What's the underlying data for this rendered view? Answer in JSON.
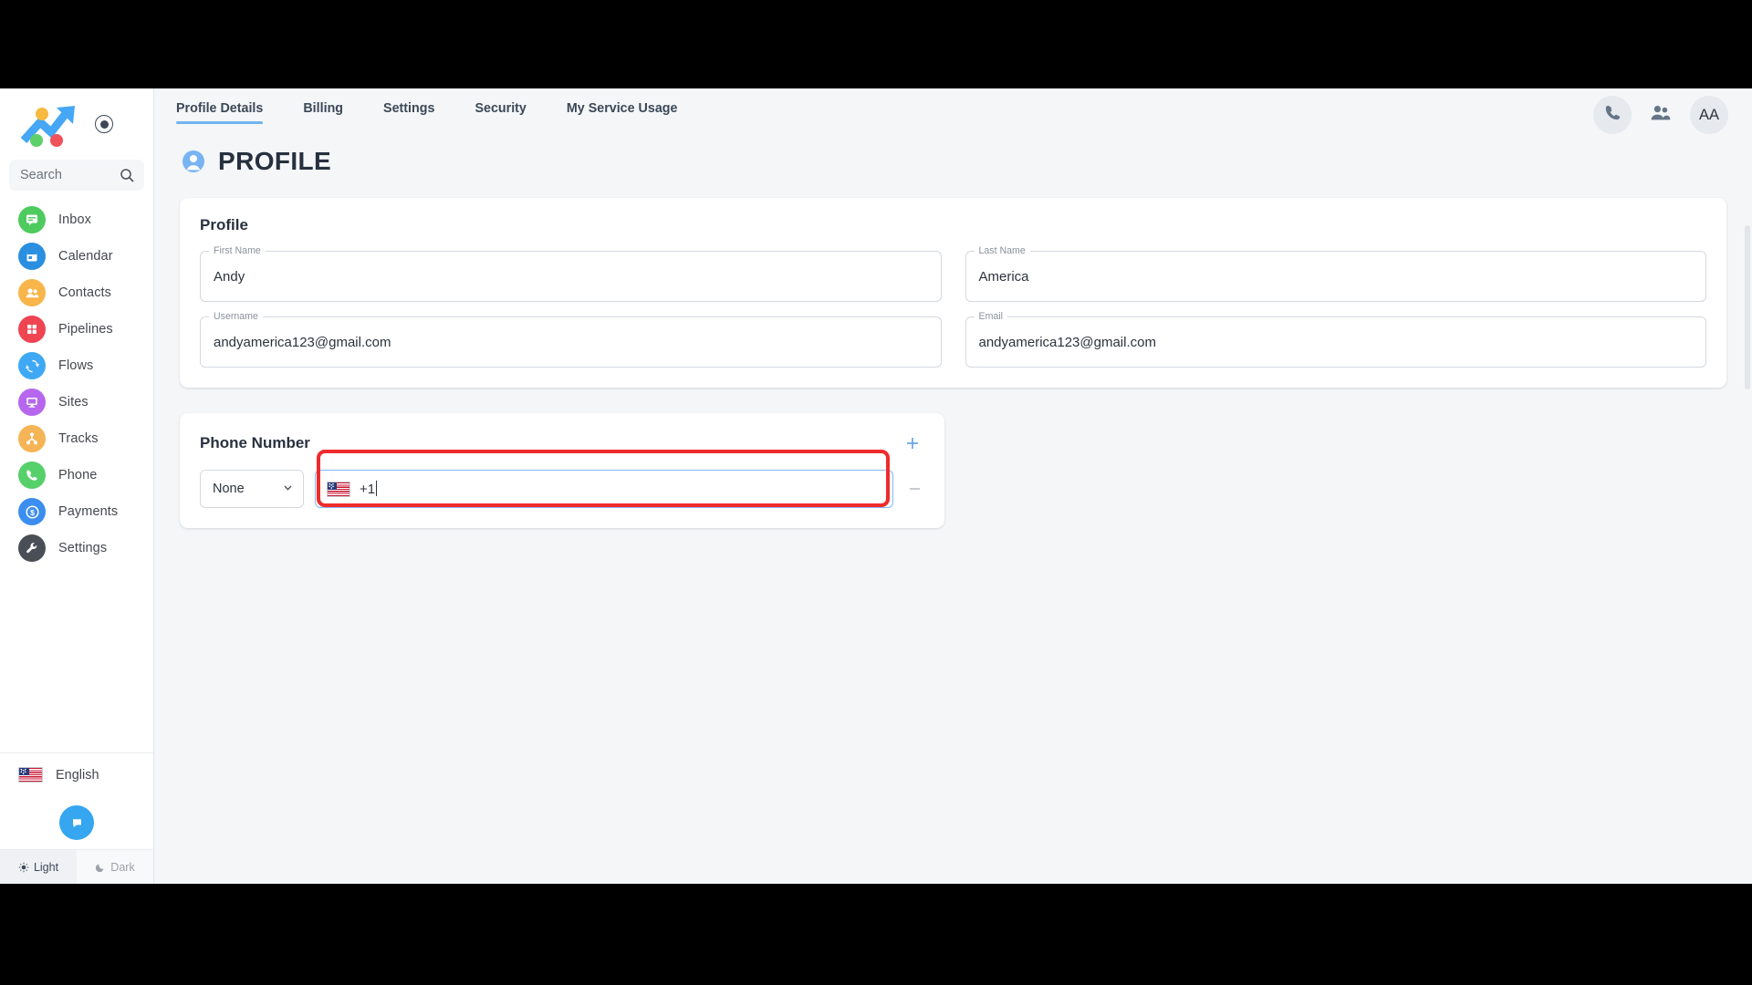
{
  "sidebar": {
    "logo_name": "growth-chart-logo",
    "record_button": "record-indicator",
    "search": {
      "placeholder": "Search",
      "value": ""
    },
    "items": [
      {
        "label": "Inbox",
        "icon": "inbox-icon",
        "color": "#4ecb5e"
      },
      {
        "label": "Calendar",
        "icon": "calendar-icon",
        "color": "#2a8fe0"
      },
      {
        "label": "Contacts",
        "icon": "contacts-icon",
        "color": "#f7b54a"
      },
      {
        "label": "Pipelines",
        "icon": "pipelines-icon",
        "color": "#ef4452"
      },
      {
        "label": "Flows",
        "icon": "flows-icon",
        "color": "#3fa8f4"
      },
      {
        "label": "Sites",
        "icon": "sites-icon",
        "color": "#b766ee"
      },
      {
        "label": "Tracks",
        "icon": "tracks-icon",
        "color": "#f5b456"
      },
      {
        "label": "Phone",
        "icon": "phone-icon",
        "color": "#56d06a"
      },
      {
        "label": "Payments",
        "icon": "payments-icon",
        "color": "#3b8ef0"
      },
      {
        "label": "Settings",
        "icon": "settings-icon",
        "color": "#4a4f57"
      }
    ],
    "language": {
      "label": "English",
      "flag": "us-flag-icon"
    },
    "chat_widget": "chat-bubble-icon",
    "theme": {
      "light_label": "Light",
      "dark_label": "Dark",
      "active": "Light"
    }
  },
  "topbar": {
    "tabs": [
      {
        "label": "Profile Details",
        "active": true
      },
      {
        "label": "Billing",
        "active": false
      },
      {
        "label": "Settings",
        "active": false
      },
      {
        "label": "Security",
        "active": false
      },
      {
        "label": "My Service Usage",
        "active": false
      }
    ],
    "actions": {
      "call_icon": "phone-handset-icon",
      "people_icon": "people-icon",
      "avatar_initials": "AA"
    },
    "active_tab_color": "#72b4f0"
  },
  "page": {
    "title": "PROFILE",
    "title_icon": "user-circle-icon"
  },
  "profile_card": {
    "title": "Profile",
    "fields": [
      {
        "label": "First Name",
        "value": "Andy"
      },
      {
        "label": "Last Name",
        "value": "America"
      },
      {
        "label": "Username",
        "value": "andyamerica123@gmail.com"
      },
      {
        "label": "Email",
        "value": "andyamerica123@gmail.com"
      }
    ]
  },
  "phone_card": {
    "title": "Phone Number",
    "add_label": "+",
    "type_select": {
      "value": "None",
      "options": [
        "None"
      ]
    },
    "country_flag": "us-flag-icon",
    "number_value": "+1",
    "remove_label": "remove-phone-row"
  },
  "annotation": {
    "color": "#ef2b2b",
    "target": "phone-number-input"
  }
}
